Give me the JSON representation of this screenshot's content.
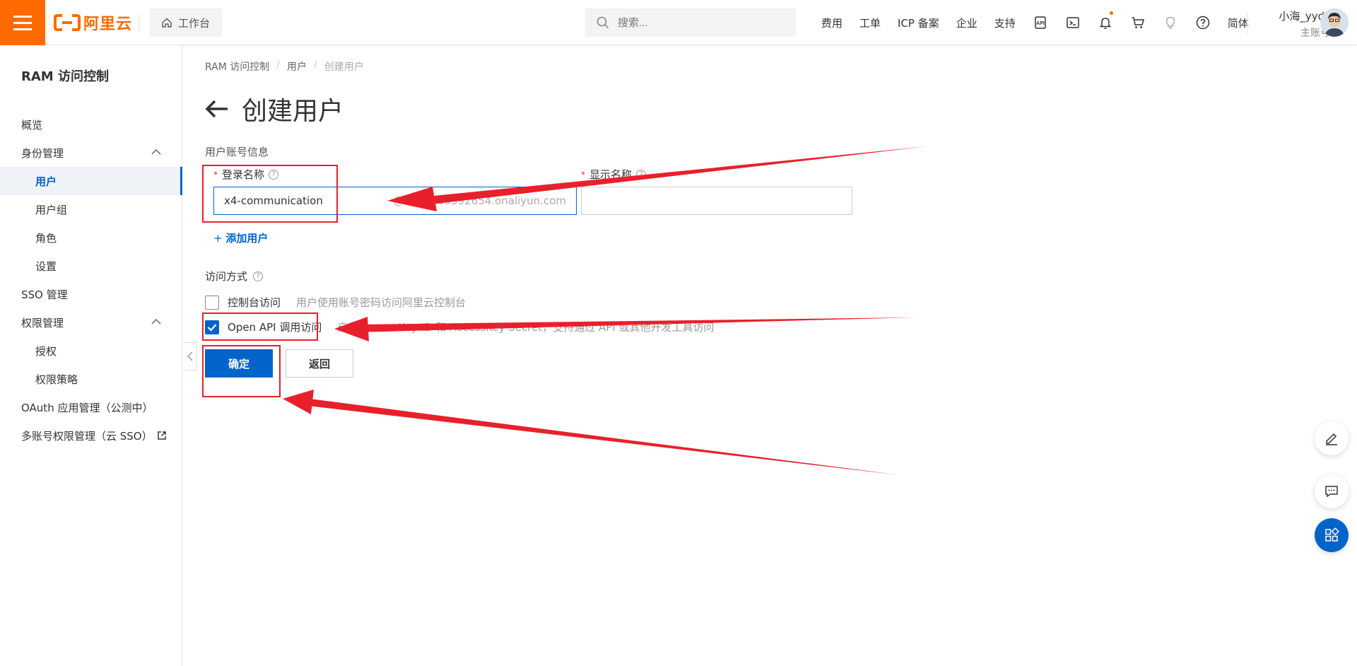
{
  "topbar": {
    "logo_text": "阿里云",
    "workbench_label": "工作台",
    "search_placeholder": "搜索...",
    "nav_links": [
      "费用",
      "工单",
      "ICP 备案",
      "企业",
      "支持"
    ],
    "lang_label": "简体",
    "user_name": "小海_yyds",
    "user_role": "主账号",
    "brand_color": "#ff6a00"
  },
  "sidebar": {
    "title": "RAM 访问控制",
    "items": [
      {
        "label": "概览"
      },
      {
        "label": "身份管理"
      },
      {
        "label": "用户"
      },
      {
        "label": "用户组"
      },
      {
        "label": "角色"
      },
      {
        "label": "设置"
      },
      {
        "label": "SSO 管理"
      },
      {
        "label": "权限管理"
      },
      {
        "label": "授权"
      },
      {
        "label": "权限策略"
      },
      {
        "label": "OAuth 应用管理（公测中）"
      },
      {
        "label": "多账号权限管理（云 SSO）"
      }
    ]
  },
  "breadcrumb": [
    "RAM 访问控制",
    "用户",
    "创建用户"
  ],
  "page": {
    "title": "创建用户",
    "section_label": "用户账号信息",
    "login_name_label": "登录名称",
    "display_name_label": "显示名称",
    "login_name_value": "x4-communication",
    "login_name_suffix": "@1520700392654.onaliyun.com",
    "display_name_value": "",
    "add_user_label": "添加用户",
    "access_label": "访问方式",
    "console_access_label": "控制台访问",
    "console_access_desc": "用户使用账号密码访问阿里云控制台",
    "console_access_checked": false,
    "api_access_label": "Open API 调用访问",
    "api_access_desc": "启用 AccessKey ID 和 AccessKey Secret，支持通过 API 或其他开发工具访问",
    "api_access_checked": true,
    "confirm_label": "确定",
    "back_label": "返回",
    "accent_color": "#0064c8",
    "annotation_color": "#e8202b"
  }
}
